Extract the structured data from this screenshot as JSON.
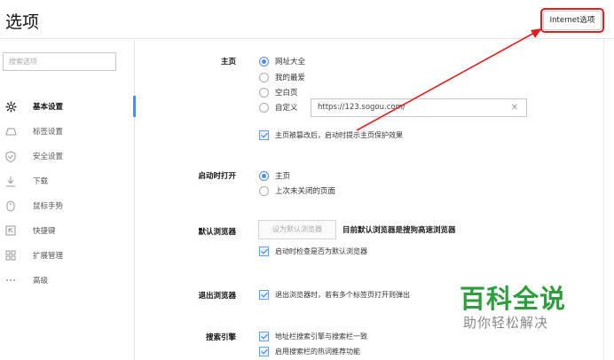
{
  "header": {
    "title": "选项",
    "ie_button_label": "Internet选项"
  },
  "sidebar": {
    "search_placeholder": "搜索选项",
    "items": [
      {
        "label": "基本设置",
        "icon": "gear-icon",
        "active": true
      },
      {
        "label": "标签设置",
        "icon": "tab-icon"
      },
      {
        "label": "安全设置",
        "icon": "shield-icon"
      },
      {
        "label": "下载",
        "icon": "download-icon"
      },
      {
        "label": "鼠标手势",
        "icon": "mouse-icon"
      },
      {
        "label": "快捷键",
        "icon": "shortcut-icon"
      },
      {
        "label": "扩展管理",
        "icon": "extension-icon"
      },
      {
        "label": "高级",
        "icon": "more-icon"
      }
    ]
  },
  "homepage": {
    "label": "主页",
    "options": [
      "网址大全",
      "我的最爱",
      "空白页",
      "自定义"
    ],
    "selected": "网址大全",
    "custom_url": "https://123.sogou.com/",
    "protect_checkbox": "主页被篡改后，启动时提示主页保护效果"
  },
  "startup": {
    "label": "启动时打开",
    "options": [
      "主页",
      "上次未关闭的页面"
    ],
    "selected": "主页"
  },
  "default_browser": {
    "label": "默认浏览器",
    "button": "设为默认浏览器",
    "status": "目前默认浏览器是搜狗高速浏览器",
    "check_label": "启动时检查是否为默认浏览器"
  },
  "exit": {
    "label": "退出浏览器",
    "check_label": "退出浏览器时，若有多个标签页打开则弹出"
  },
  "search_engine": {
    "label": "搜索引擎",
    "check1": "地址栏搜索引擎与搜索栏一致",
    "check2": "启用搜索栏的热词推荐功能"
  },
  "watermark": {
    "title": "百科全说",
    "subtitle": "助你轻松解决"
  },
  "colors": {
    "accent": "#4d8ef0",
    "annotation": "#e02020",
    "watermark_green": "#2d9d3e"
  }
}
